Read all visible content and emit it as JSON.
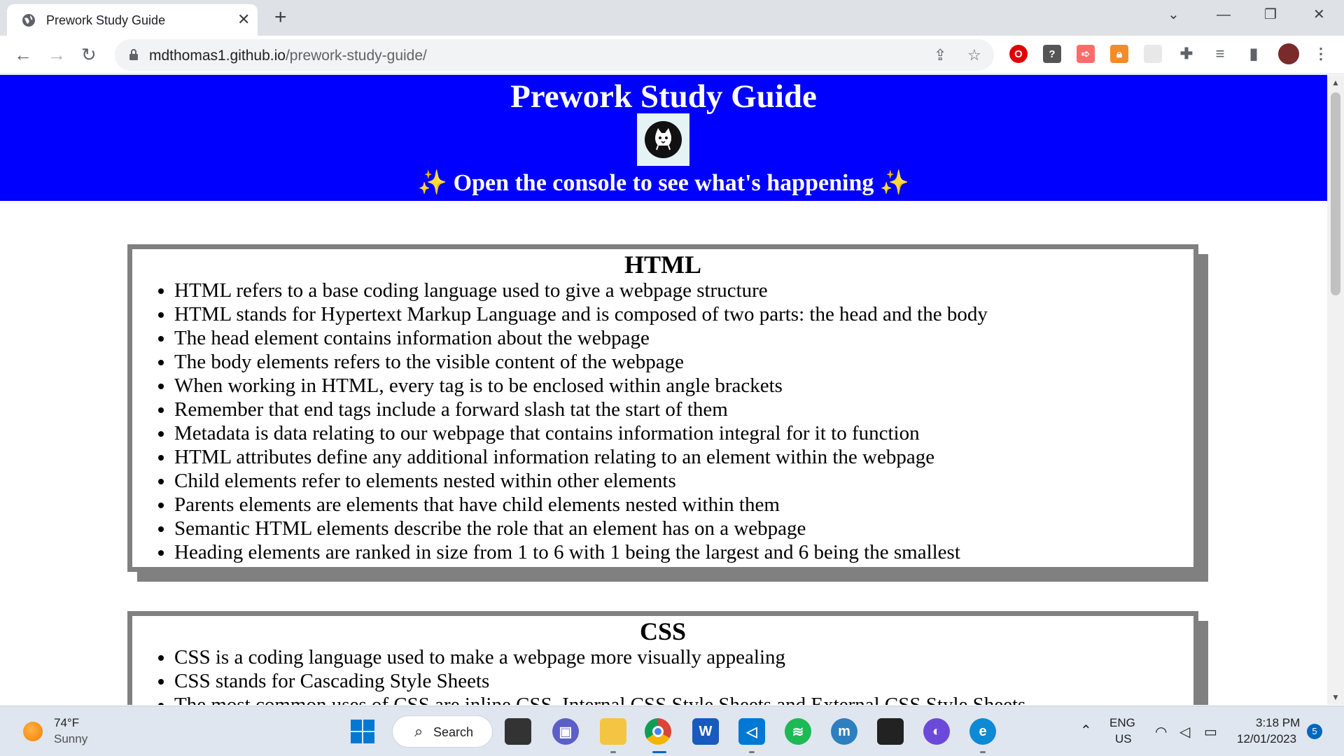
{
  "browser": {
    "tab_title": "Prework Study Guide",
    "tab_close": "✕",
    "new_tab": "+",
    "url_host": "mdthomas1.github.io",
    "url_path": "/prework-study-guide/"
  },
  "page": {
    "title": "Prework Study Guide",
    "subtitle": "Open the console to see what's happening",
    "sparkle": "✨"
  },
  "sections": [
    {
      "heading": "HTML",
      "items": [
        "HTML refers to a base coding language used to give a webpage structure",
        "HTML stands for Hypertext Markup Language and is composed of two parts: the head and the body",
        "The head element contains information about the webpage",
        "The body elements refers to the visible content of the webpage",
        "When working in HTML, every tag is to be enclosed within angle brackets",
        "Remember that end tags include a forward slash tat the start of them",
        "Metadata is data relating to our webpage that contains information integral for it to function",
        "HTML attributes define any additional information relating to an element within the webpage",
        "Child elements refer to elements nested within other elements",
        "Parents elements are elements that have child elements nested within them",
        "Semantic HTML elements describe the role that an element has on a webpage",
        "Heading elements are ranked in size from 1 to 6 with 1 being the largest and 6 being the smallest"
      ]
    },
    {
      "heading": "CSS",
      "items": [
        "CSS is a coding language used to make a webpage more visually appealing",
        "CSS stands for Cascading Style Sheets",
        "The most common uses of CSS are inline CSS, Internal CSS Style Sheets and External CSS Style Sheets"
      ]
    }
  ],
  "taskbar": {
    "weather_temp": "74°F",
    "weather_cond": "Sunny",
    "search_label": "Search",
    "lang_top": "ENG",
    "lang_bottom": "US",
    "time": "3:18 PM",
    "date": "12/01/2023",
    "notification_count": "5"
  },
  "colors": {
    "header_bg": "#0000ff",
    "card_border": "#808080"
  }
}
